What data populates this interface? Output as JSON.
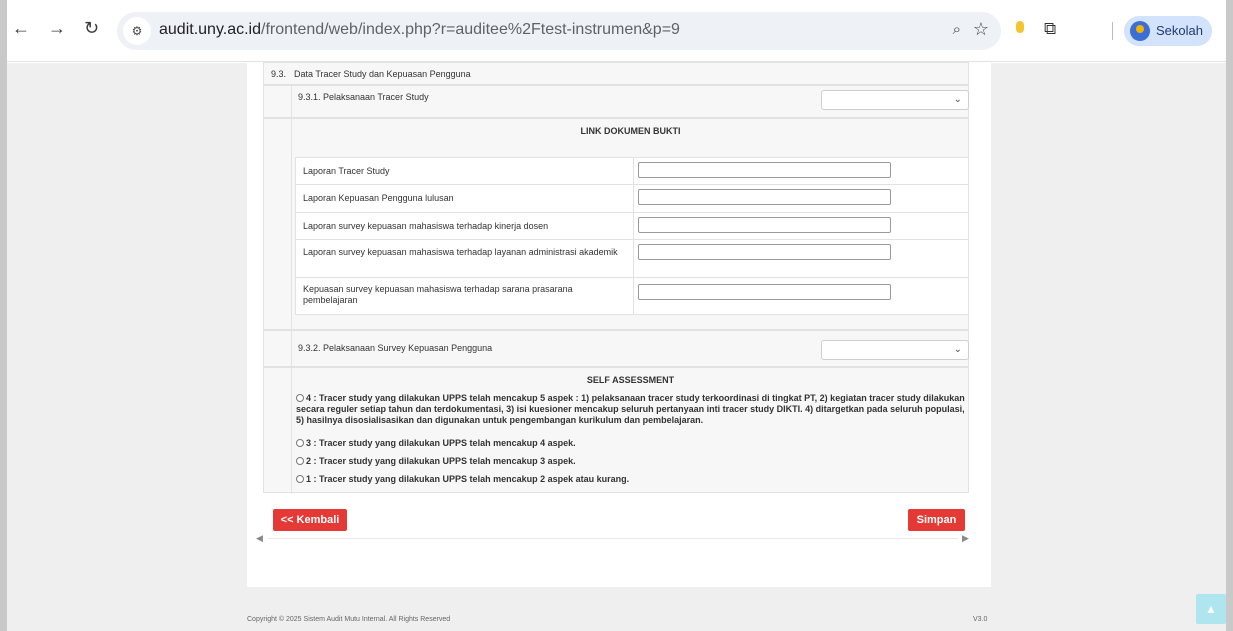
{
  "browser": {
    "url_host": "audit.uny.ac.id",
    "url_path": "/frontend/web/index.php?r=auditee%2Ftest-instrumen&p=9",
    "profile_name": "Sekolah"
  },
  "section": {
    "number": "9.3.",
    "title": "Data Tracer Study dan Kepuasan Pengguna",
    "item1": {
      "label": "9.3.1. Pelaksanaan Tracer Study",
      "selected": ""
    },
    "link_heading": "LINK DOKUMEN BUKTI",
    "documents": [
      {
        "label": "Laporan Tracer Study",
        "value": ""
      },
      {
        "label": "Laporan Kepuasan Pengguna lulusan",
        "value": ""
      },
      {
        "label": "Laporan survey kepuasan mahasiswa terhadap kinerja dosen",
        "value": ""
      },
      {
        "label": "Laporan survey kepuasan mahasiswa terhadap layanan administrasi akademik",
        "value": ""
      },
      {
        "label": "Kepuasan survey kepuasan mahasiswa terhadap sarana prasarana pembelajaran",
        "value": ""
      }
    ],
    "item2": {
      "label": "9.3.2. Pelaksanaan Survey Kepuasan Pengguna",
      "selected": ""
    },
    "self_heading": "SELF ASSESSMENT",
    "options": [
      {
        "text": "4 : Tracer study yang dilakukan UPPS telah mencakup 5 aspek : 1) pelaksanaan tracer study terkoordinasi di tingkat PT, 2) kegiatan tracer study dilakukan secara reguler setiap tahun dan terdokumentasi, 3) isi kuesioner mencakup seluruh pertanyaan inti tracer study DIKTI. 4) ditargetkan pada seluruh populasi, 5) hasilnya disosialisasikan dan digunakan untuk pengembangan kurikulum dan pembelajaran."
      },
      {
        "text": "3 : Tracer study yang dilakukan UPPS telah mencakup 4 aspek."
      },
      {
        "text": "2 : Tracer study yang dilakukan UPPS telah mencakup 3 aspek."
      },
      {
        "text": "1 : Tracer study yang dilakukan UPPS telah mencakup 2 aspek atau kurang."
      }
    ]
  },
  "buttons": {
    "back": "<< Kembali",
    "save": "Simpan"
  },
  "footer": {
    "copyright": "Copyright © 2025 Sistem Audit Mutu Internal. All Rights Reserved",
    "version": "V3.0"
  }
}
